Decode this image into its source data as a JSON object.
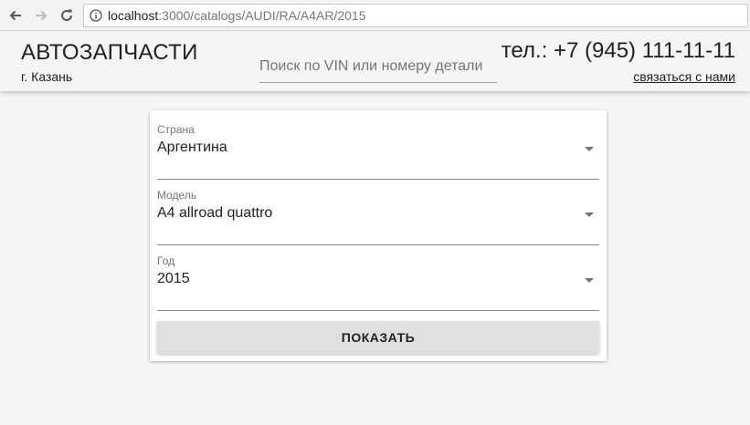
{
  "browser": {
    "url_host": "localhost",
    "url_path": ":3000/catalogs/AUDI/RA/A4AR/2015"
  },
  "header": {
    "brand": "АВТОЗАПЧАСТИ",
    "city": "г. Казань",
    "search_placeholder": "Поиск по VIN или номеру детали",
    "phone": "тел.: +7 (945) 111-11-11",
    "contact_link": "связаться с нами"
  },
  "form": {
    "fields": [
      {
        "label": "Страна",
        "value": "Аргентина"
      },
      {
        "label": "Модель",
        "value": "A4 allroad quattro"
      },
      {
        "label": "Год",
        "value": "2015"
      }
    ],
    "submit_label": "ПОКАЗАТЬ"
  }
}
